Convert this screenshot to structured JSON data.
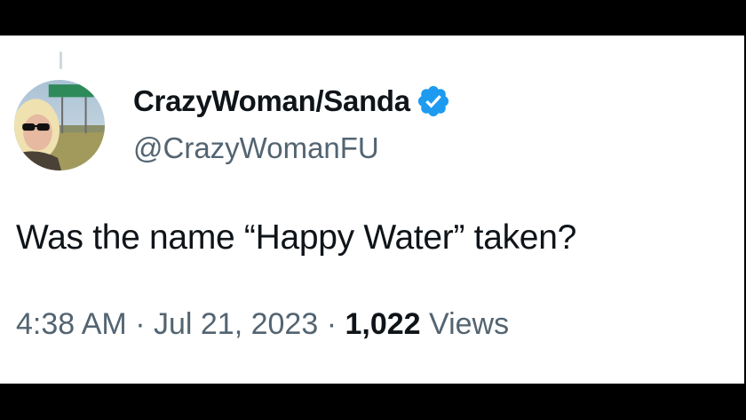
{
  "tweet": {
    "author": {
      "display_name": "CrazyWoman/Sanda",
      "handle": "@CrazyWomanFU",
      "verified": true,
      "avatar_icon": "profile-photo",
      "verified_icon": "verified-badge-icon",
      "verified_color": "#1d9bf0"
    },
    "text": "Was the name “Happy Water” taken?",
    "meta": {
      "time": "4:38 AM",
      "separator": "·",
      "date": "Jul 21, 2023",
      "views_count": "1,022",
      "views_label": "Views"
    }
  },
  "colors": {
    "primary_text": "#0f1419",
    "secondary_text": "#536471",
    "background": "#ffffff",
    "frame": "#000000"
  }
}
